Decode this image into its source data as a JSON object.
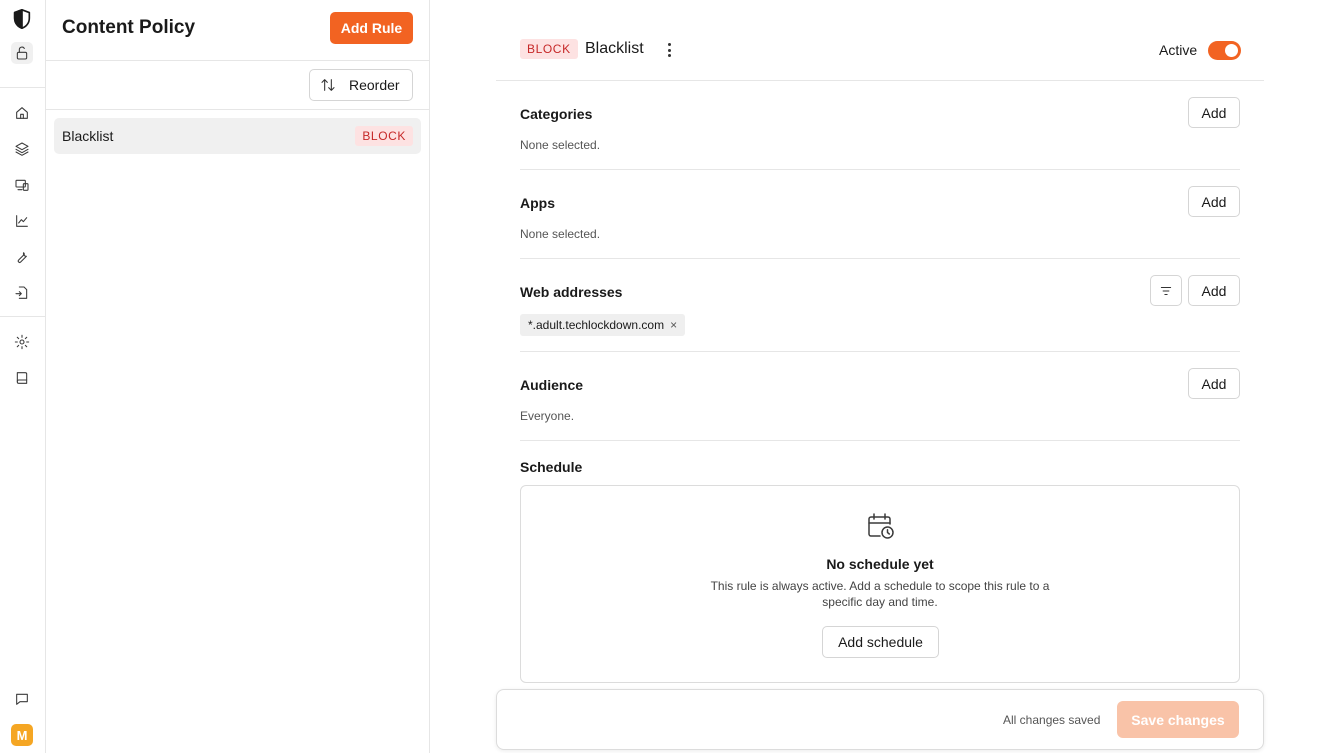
{
  "rail": {
    "icons": [
      "shield-logo-icon",
      "lock-icon",
      "home-icon",
      "layers-icon",
      "devices-icon",
      "chart-icon",
      "wrench-icon",
      "file-transfer-icon",
      "gear-icon",
      "book-icon",
      "chat-icon"
    ],
    "selected": "layers-icon",
    "avatar_initial": "M",
    "avatar_color": "#f5a623"
  },
  "list_panel": {
    "title": "Content Policy",
    "add_rule_label": "Add Rule",
    "reorder_label": "Reorder",
    "rules": [
      {
        "name": "Blacklist",
        "badge": "BLOCK"
      }
    ]
  },
  "detail": {
    "badge": "BLOCK",
    "rule_name": "Blacklist",
    "active_label": "Active",
    "active": true,
    "sections": {
      "categories": {
        "title": "Categories",
        "add_label": "Add",
        "summary": "None selected."
      },
      "apps": {
        "title": "Apps",
        "add_label": "Add",
        "summary": "None selected."
      },
      "web_addresses": {
        "title": "Web addresses",
        "add_label": "Add",
        "entries": [
          {
            "value": "*.adult.techlockdown.com",
            "remove": "×"
          }
        ]
      },
      "audience": {
        "title": "Audience",
        "add_label": "Add",
        "summary": "Everyone."
      },
      "schedule": {
        "title": "Schedule",
        "empty_title": "No schedule yet",
        "empty_desc": "This rule is always active. Add a schedule to scope this rule to a specific day and time.",
        "add_label": "Add schedule"
      }
    },
    "save_bar": {
      "status": "All changes saved",
      "save_label": "Save changes"
    }
  },
  "colors": {
    "accent": "#f26322",
    "accent_disabled": "#f9c3a8",
    "block_badge_bg": "#fde2e2",
    "block_badge_text": "#c62828"
  }
}
